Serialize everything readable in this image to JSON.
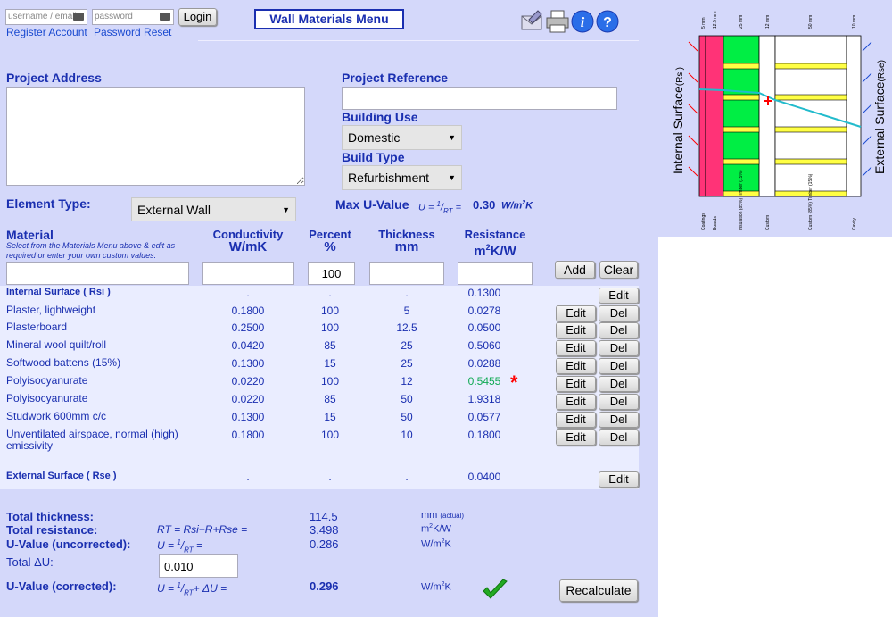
{
  "login": {
    "username_placeholder": "username / email",
    "password_placeholder": "password",
    "login_label": "Login",
    "register_label": "Register Account",
    "reset_label": "Password Reset"
  },
  "menu_button": "Wall Materials Menu",
  "project": {
    "address_label": "Project Address",
    "reference_label": "Project Reference",
    "building_use_label": "Building Use",
    "building_use_value": "Domestic",
    "build_type_label": "Build Type",
    "build_type_value": "Refurbishment"
  },
  "element": {
    "label": "Element Type:",
    "value": "External Wall",
    "max_u_label": "Max U-Value",
    "max_u_formula": "U = 1/RT =",
    "max_u_value": "0.30",
    "max_u_unit": "W/m2K"
  },
  "table": {
    "headers": {
      "material": "Material",
      "material_hint": "Select from the Materials Menu above & edit as required or enter your own custom values.",
      "conductivity": "Conductivity",
      "conductivity_unit": "W/mK",
      "percent": "Percent",
      "percent_unit": "%",
      "thickness": "Thickness",
      "thickness_unit": "mm",
      "resistance": "Resistance",
      "resistance_unit": "m2K/W"
    },
    "new_row": {
      "percent": "100",
      "add_label": "Add",
      "clear_label": "Clear"
    },
    "edit_label": "Edit",
    "del_label": "Del",
    "rows": [
      {
        "material": "Internal Surface ( Rsi )",
        "conductivity": ".",
        "percent": ".",
        "thickness": ".",
        "resistance": "0.1300"
      },
      {
        "material": "Plaster, lightweight",
        "conductivity": "0.1800",
        "percent": "100",
        "thickness": "5",
        "resistance": "0.0278"
      },
      {
        "material": "Plasterboard",
        "conductivity": "0.2500",
        "percent": "100",
        "thickness": "12.5",
        "resistance": "0.0500"
      },
      {
        "material": "Mineral wool quilt/roll",
        "conductivity": "0.0420",
        "percent": "85",
        "thickness": "25",
        "resistance": "0.5060"
      },
      {
        "material": "Softwood battens (15%)",
        "conductivity": "0.1300",
        "percent": "15",
        "thickness": "25",
        "resistance": "0.0288"
      },
      {
        "material": "Polyisocyanurate",
        "conductivity": "0.0220",
        "percent": "100",
        "thickness": "12",
        "resistance": "0.5455",
        "flag": "*"
      },
      {
        "material": "Polyisocyanurate",
        "conductivity": "0.0220",
        "percent": "85",
        "thickness": "50",
        "resistance": "1.9318"
      },
      {
        "material": "Studwork 600mm c/c",
        "conductivity": "0.1300",
        "percent": "15",
        "thickness": "50",
        "resistance": "0.0577"
      },
      {
        "material": "Unventilated airspace, normal (high) emissivity",
        "conductivity": "0.1800",
        "percent": "100",
        "thickness": "10",
        "resistance": "0.1800"
      },
      {
        "material": "External Surface ( Rse )",
        "conductivity": ".",
        "percent": ".",
        "thickness": ".",
        "resistance": "0.0400"
      }
    ]
  },
  "totals": {
    "thickness_label": "Total thickness:",
    "thickness_value": "114.5",
    "thickness_unit": "mm",
    "thickness_note": "(actual)",
    "resistance_label": "Total resistance:",
    "resistance_formula": "RT = Rsi+R+Rse =",
    "resistance_value": "3.498",
    "resistance_unit": "m2K/W",
    "u_unc_label": "U-Value (uncorrected):",
    "u_unc_formula": "U = 1/RT =",
    "u_unc_value": "0.286",
    "u_unc_unit": "W/m2K",
    "delta_label": "Total ΔU:",
    "delta_value": "0.010",
    "u_cor_label": "U-Value (corrected):",
    "u_cor_formula": "U = 1/RT+ ΔU =",
    "u_cor_value": "0.296",
    "u_cor_unit": "W/m2K",
    "recalc_label": "Recalculate"
  },
  "diagram": {
    "top_labels": [
      "5 mm",
      "12.5 mm",
      "25 mm",
      "12 mm",
      "50 mm",
      "10 mm"
    ],
    "bottom_labels": [
      "Coatings",
      "Boards",
      "Insulation (85%) Timber (15%)",
      "Custom",
      "Custom (85%) Timber (15%)",
      "Cavity"
    ],
    "internal_label": "Internal Surface",
    "internal_sub": "(Rsi)",
    "external_label": "External Surface",
    "external_sub": "(Rse)"
  },
  "colors": {
    "panel": "#d4d8fa",
    "label_blue": "#1a2fb0",
    "insulation_green": "#00ee44",
    "batten_yellow": "#ffff44",
    "plaster_pink": "#ff3377",
    "flag_red": "#ff0000",
    "check_green": "#22aa22"
  }
}
